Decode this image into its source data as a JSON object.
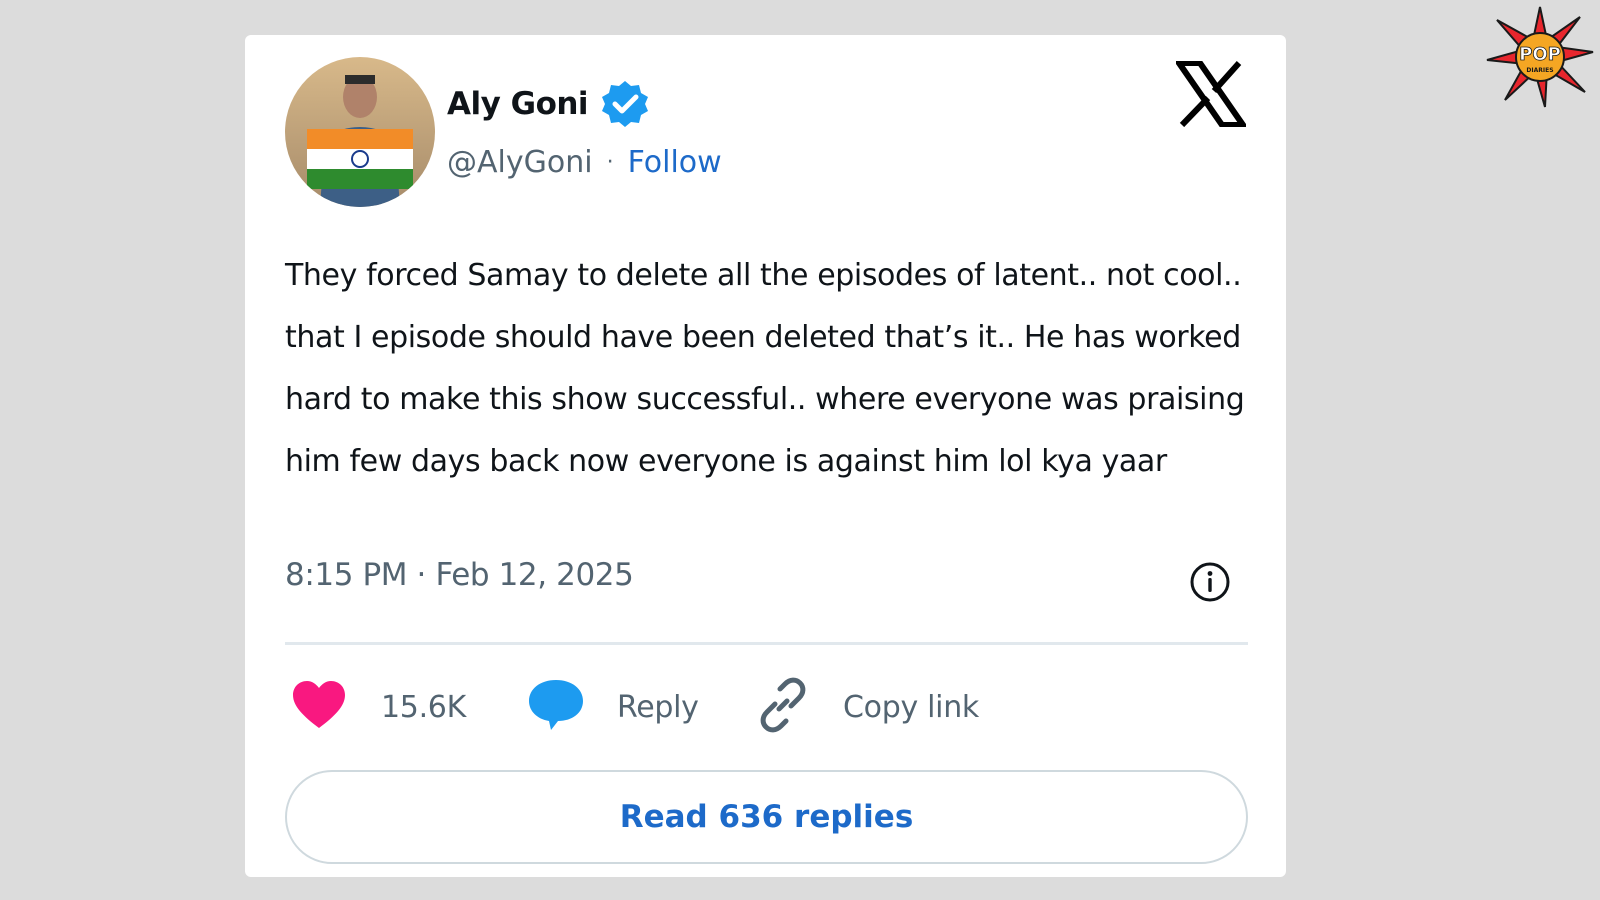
{
  "author": {
    "name": "Aly Goni",
    "handle": "@AlyGoni",
    "follow_label": "Follow",
    "verified": true,
    "verified_color": "#1d9bf0"
  },
  "tweet": {
    "text": "They forced Samay to delete all the episodes of latent.. not cool.. that I episode should have been deleted that’s it.. He has worked hard to make this show successful.. where everyone was praising him few days back now everyone is against him lol kya yaar",
    "timestamp": "8:15 PM · Feb 12, 2025"
  },
  "actions": {
    "like_count": "15.6K",
    "reply_label": "Reply",
    "copy_label": "Copy link",
    "read_replies_label": "Read 636 replies"
  },
  "icons": {
    "platform": "x-logo-icon",
    "like": "heart-icon",
    "reply": "speech-bubble-icon",
    "copy": "link-icon",
    "info": "info-icon",
    "verified": "verified-badge-icon"
  },
  "colors": {
    "like": "#f91880",
    "reply": "#1d9bf0",
    "link_text": "#1d6ac9",
    "muted_text": "#536471"
  },
  "watermark": {
    "logo_text": "POP DIARIES"
  }
}
